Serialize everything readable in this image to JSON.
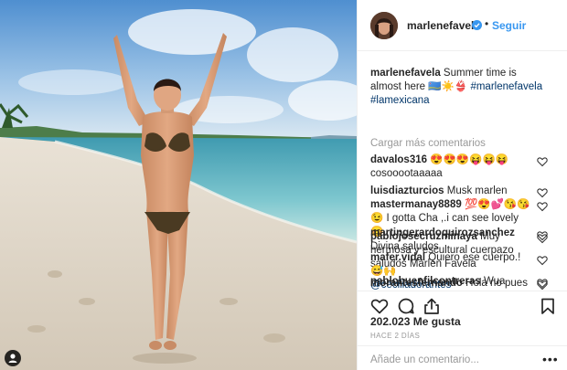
{
  "post": {
    "username": "marlenefavela",
    "follow_label": "Seguir",
    "separator": "•",
    "caption_text": "Summer time is almost here 🇦🇼☀️👙",
    "hashtags": [
      "#marlenefavela",
      "#lamexicana"
    ],
    "load_more": "Cargar más comentarios",
    "likes": "202.023 Me gusta",
    "time_ago": "HACE 2 DÍAS",
    "add_comment_placeholder": "Añade un comentario...",
    "more_options": "•••"
  },
  "comments": [
    {
      "user": "davalos316",
      "text": "😍😍😍😝😝😝 cosooootaaaaa"
    },
    {
      "user": "luisdiazturcios",
      "text": "Musk marlen"
    },
    {
      "user": "mastermanay8889",
      "text": "💯😍💕😘😘😉 I gotta Cha ,.i can see lovely 😊"
    },
    {
      "user": "pablojosecruzminaya",
      "text": "Muy hermosa y escultural cuerpazo saludos Marlen Favela"
    },
    {
      "user": "pablobuenfilcontreras",
      "text": "Wua hermosa y cuerpazo"
    },
    {
      "user": "martingerardoquirozsanchez",
      "text": "Divina saludos"
    },
    {
      "user": "mafer.vidal",
      "text": "Quiero ese cuerpo.! 😅🙌",
      "mention": "@ceciliadorantes"
    },
    {
      "user": "morantesfernando",
      "text": "Hola no pues la"
    }
  ],
  "icons": {
    "verified": "verified-badge-icon",
    "like": "heart-icon",
    "comment": "comment-bubble-icon",
    "share": "share-icon",
    "save": "bookmark-icon",
    "tag": "user-tag-icon"
  },
  "colors": {
    "link_blue": "#3897f0",
    "hashtag_blue": "#003569",
    "text": "#262626",
    "muted": "#999999"
  }
}
